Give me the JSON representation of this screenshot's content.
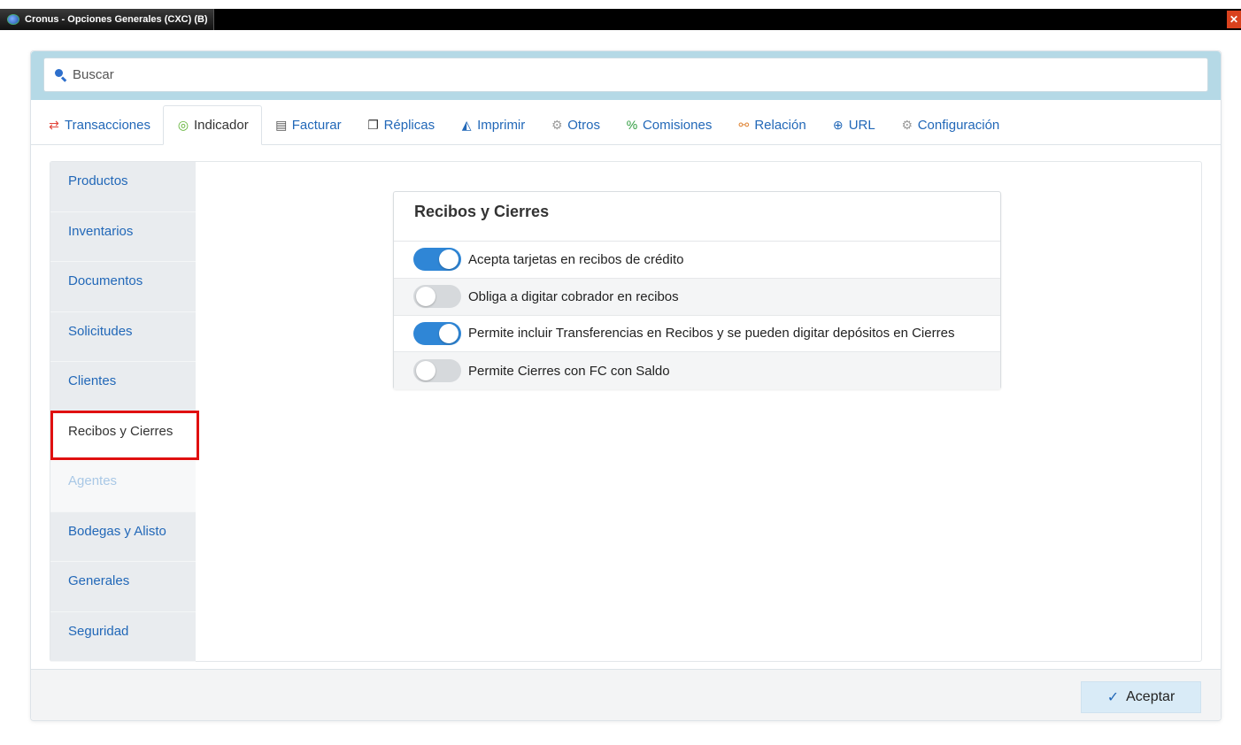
{
  "window": {
    "title": "Cronus - Opciones Generales (CXC) (B)",
    "close_glyph": "✕"
  },
  "search": {
    "placeholder": "Buscar",
    "icon": "search-icon"
  },
  "tabs": [
    {
      "label": "Transacciones",
      "icon": "exchange-icon",
      "glyph": "⇄",
      "color": "#e2463b",
      "active": false
    },
    {
      "label": "Indicador",
      "icon": "target-icon",
      "glyph": "◎",
      "color": "#5cb030",
      "active": true
    },
    {
      "label": "Facturar",
      "icon": "invoice-icon",
      "glyph": "▤",
      "color": "#555555",
      "active": false
    },
    {
      "label": "Réplicas",
      "icon": "copy-icon",
      "glyph": "❐",
      "color": "#333333",
      "active": false
    },
    {
      "label": "Imprimir",
      "icon": "area-chart-icon",
      "glyph": "◭",
      "color": "#2268b8",
      "active": false
    },
    {
      "label": "Otros",
      "icon": "gears-icon",
      "glyph": "⚙",
      "color": "#9a9a9a",
      "active": false
    },
    {
      "label": "Comisiones",
      "icon": "percent-icon",
      "glyph": "%",
      "color": "#2a9a3a",
      "active": false
    },
    {
      "label": "Relación",
      "icon": "link-icon",
      "glyph": "⚯",
      "color": "#e0883a",
      "active": false
    },
    {
      "label": "URL",
      "icon": "globe-icon",
      "glyph": "⊕",
      "color": "#2268b8",
      "active": false
    },
    {
      "label": "Configuración",
      "icon": "gear-icon",
      "glyph": "⚙",
      "color": "#9a9a9a",
      "active": false
    }
  ],
  "sidebar": {
    "items": [
      {
        "label": "Productos",
        "state": "normal"
      },
      {
        "label": "Inventarios",
        "state": "normal"
      },
      {
        "label": "Documentos",
        "state": "normal"
      },
      {
        "label": "Solicitudes",
        "state": "normal"
      },
      {
        "label": "Clientes",
        "state": "normal"
      },
      {
        "label": "Recibos y Cierres",
        "state": "selected"
      },
      {
        "label": "Agentes",
        "state": "disabled"
      },
      {
        "label": "Bodegas y Alisto",
        "state": "normal"
      },
      {
        "label": "Generales",
        "state": "normal"
      },
      {
        "label": "Seguridad",
        "state": "normal"
      }
    ]
  },
  "card": {
    "title": "Recibos y Cierres",
    "options": [
      {
        "label": "Acepta tarjetas en recibos de crédito",
        "enabled": true
      },
      {
        "label": "Obliga a digitar cobrador en recibos",
        "enabled": false
      },
      {
        "label": "Permite incluir Transferencias en Recibos y se pueden digitar depósitos en Cierres",
        "enabled": true
      },
      {
        "label": "Permite Cierres con FC con Saldo",
        "enabled": false
      }
    ]
  },
  "footer": {
    "accept_label": "Aceptar",
    "accept_icon": "check-icon"
  },
  "colors": {
    "accent": "#2f86d6",
    "link": "#2268b8",
    "search_band": "#b5d9e6",
    "highlight": "#e01010"
  }
}
